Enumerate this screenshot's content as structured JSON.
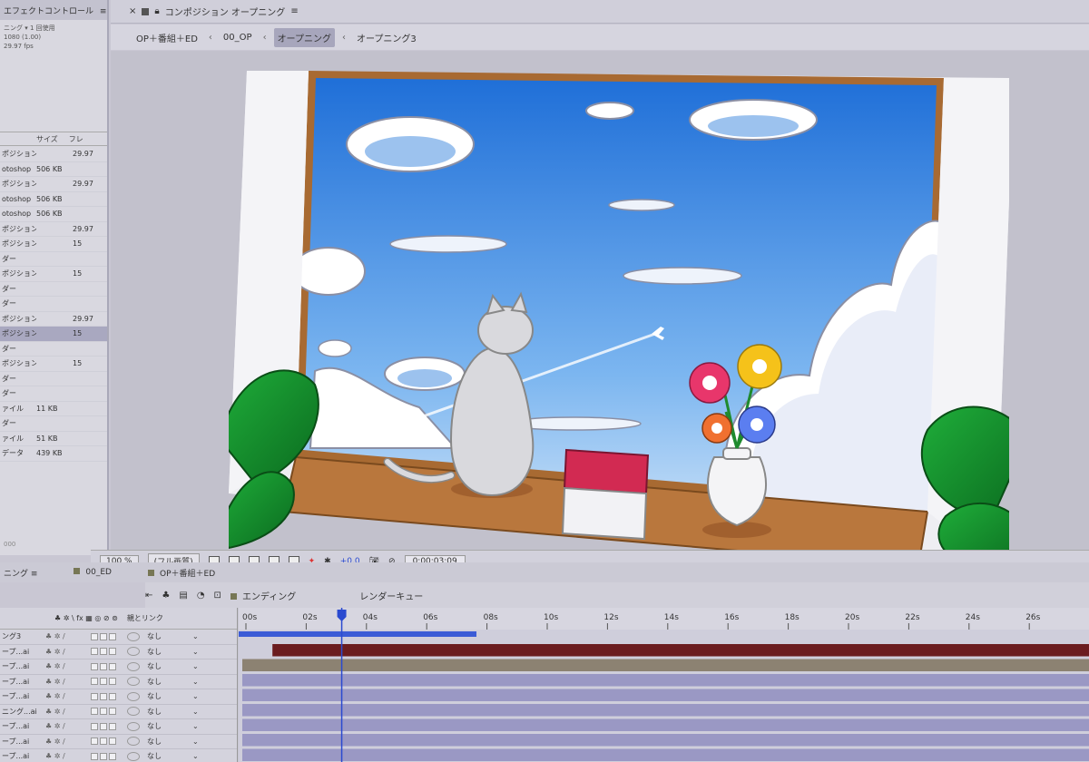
{
  "project_panel": {
    "header": "エフェクトコントロール",
    "info_lines": [
      "ニング ▾ 1 回使用",
      "1080 (1.00)",
      "29.97 fps"
    ],
    "columns": [
      "サイズ",
      "フレ"
    ],
    "rows": [
      {
        "name": "ポジション",
        "size": "",
        "fps": "29.97"
      },
      {
        "name": "otoshop",
        "size": "506 KB",
        "fps": ""
      },
      {
        "name": "ポジション",
        "size": "",
        "fps": "29.97"
      },
      {
        "name": "otoshop",
        "size": "506 KB",
        "fps": ""
      },
      {
        "name": "otoshop",
        "size": "506 KB",
        "fps": ""
      },
      {
        "name": "ポジション",
        "size": "",
        "fps": "29.97"
      },
      {
        "name": "ポジション",
        "size": "",
        "fps": "15"
      },
      {
        "name": "ダー",
        "size": "",
        "fps": ""
      },
      {
        "name": "ポジション",
        "size": "",
        "fps": "15"
      },
      {
        "name": "ダー",
        "size": "",
        "fps": ""
      },
      {
        "name": "ダー",
        "size": "",
        "fps": ""
      },
      {
        "name": "ポジション",
        "size": "",
        "fps": "29.97"
      },
      {
        "name": "ポジション",
        "size": "",
        "fps": "15"
      },
      {
        "name": "ダー",
        "size": "",
        "fps": ""
      },
      {
        "name": "ポジション",
        "size": "",
        "fps": "15"
      },
      {
        "name": "ダー",
        "size": "",
        "fps": ""
      },
      {
        "name": "ダー",
        "size": "",
        "fps": ""
      },
      {
        "name": "ァイル",
        "size": "11 KB",
        "fps": ""
      },
      {
        "name": "ダー",
        "size": "",
        "fps": ""
      },
      {
        "name": "ァイル",
        "size": "51 KB",
        "fps": ""
      },
      {
        "name": "データ",
        "size": "439 KB",
        "fps": ""
      }
    ],
    "footer": "000"
  },
  "composition": {
    "tab_title": "コンポジション オープニング",
    "breadcrumbs": [
      "OP＋番組＋ED",
      "00_OP",
      "オープニング",
      "オープニング3"
    ],
    "active_crumb": "オープニング"
  },
  "viewer_bar": {
    "zoom": "100 %",
    "resolution": "(フル画質)",
    "exposure": "+0.0",
    "timecode": "0;00;03;09"
  },
  "timeline": {
    "tabs": [
      "ニング",
      "00_ED",
      "OP＋番組＋ED"
    ],
    "sub_tabs": [
      "エンディング",
      "レンダーキュー"
    ],
    "parent_header": "親とリンク",
    "switch_header": "♣ ✲ \\ fx ▦ ◎ ⊘ ⊚",
    "ruler_labels": [
      "00s",
      "02s",
      "04s",
      "06s",
      "08s",
      "10s",
      "12s",
      "14s",
      "16s",
      "18s",
      "20s",
      "22s",
      "24s",
      "26s"
    ],
    "layers": [
      {
        "name": "ング3",
        "parent": "なし"
      },
      {
        "name": "ープ...ai",
        "parent": "なし"
      },
      {
        "name": "ープ...ai",
        "parent": "なし"
      },
      {
        "name": "ープ...ai",
        "parent": "なし"
      },
      {
        "name": "ープ...ai",
        "parent": "なし"
      },
      {
        "name": "ニング...ai",
        "parent": "なし"
      },
      {
        "name": "ープ...ai",
        "parent": "なし"
      },
      {
        "name": "ープ...ai",
        "parent": "なし"
      },
      {
        "name": "ープ...ai",
        "parent": "なし"
      }
    ],
    "playhead_seconds": 3.3,
    "colors": {
      "bar_brown": "#6b1c1f",
      "bar_tan": "#8c8272",
      "bar_purple": "#9a98c4",
      "work_area": "#3b5bd6"
    }
  }
}
